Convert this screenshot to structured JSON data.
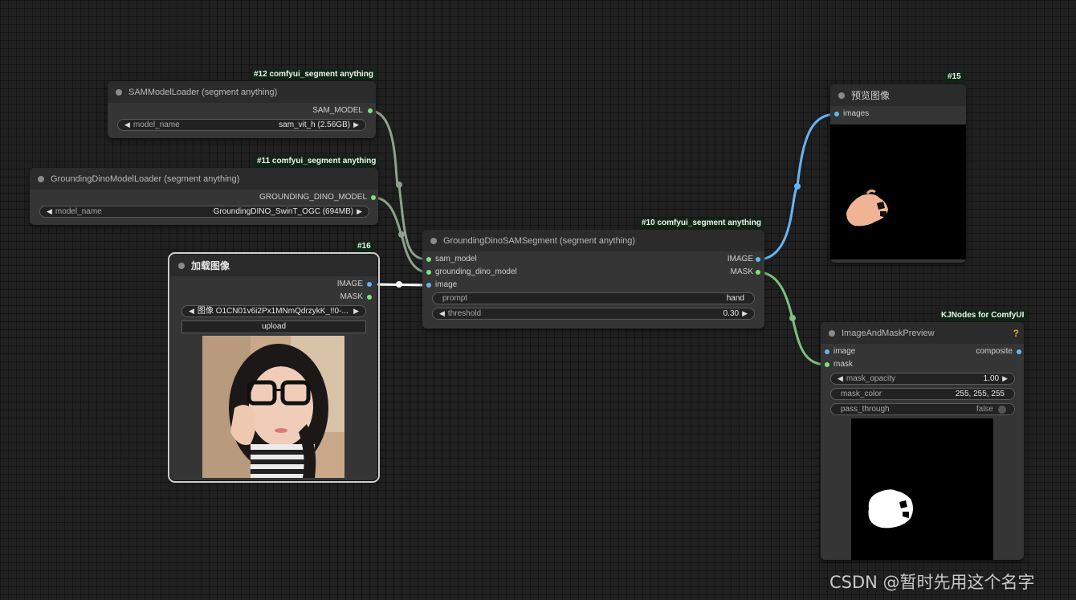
{
  "colors": {
    "canvas_bg": "#202020",
    "node_bg": "#353535",
    "node_title_bg": "#2b2b2b",
    "wire_model": "#8fa08f",
    "wire_image": "#64b5f6",
    "wire_mask": "#7ec07e",
    "wire_selected": "#ffffff",
    "slot_green": "#7ee07e",
    "slot_blue": "#64b5f6",
    "badge_bg": "#0f2614",
    "help_icon": "#f0a020"
  },
  "nodes": {
    "sam_loader": {
      "badge": "#12 comfyui_segment anything",
      "title": "SAMModelLoader (segment anything)",
      "output": "SAM_MODEL",
      "widget_label": "model_name",
      "widget_value": "sam_vit_h (2.56GB)"
    },
    "dino_loader": {
      "badge": "#11 comfyui_segment anything",
      "title": "GroundingDinoModelLoader (segment anything)",
      "output": "GROUNDING_DINO_MODEL",
      "widget_label": "model_name",
      "widget_value": "GroundingDINO_SwinT_OGC (694MB)"
    },
    "load_image": {
      "badge": "#16",
      "title": "加载图像",
      "outputs": [
        "IMAGE",
        "MASK"
      ],
      "widget_value": "图像  O1CN01v6i2Px1MNmQdrzykK_!!0-...",
      "upload_label": "upload"
    },
    "segment": {
      "badge": "#10 comfyui_segment anything",
      "title": "GroundingDinoSAMSegment (segment anything)",
      "inputs": [
        "sam_model",
        "grounding_dino_model",
        "image"
      ],
      "outputs": [
        "IMAGE",
        "MASK"
      ],
      "prompt_label": "prompt",
      "prompt_value": "hand",
      "threshold_label": "threshold",
      "threshold_value": "0.30"
    },
    "preview": {
      "badge": "#15",
      "title": "预览图像",
      "input": "images"
    },
    "mask_preview": {
      "badge": "KJNodes for ComfyUI",
      "title": "ImageAndMaskPreview",
      "help": "?",
      "inputs": [
        "image",
        "mask"
      ],
      "output": "composite",
      "mask_opacity_label": "mask_opacity",
      "mask_opacity_value": "1.00",
      "mask_color_label": "mask_color",
      "mask_color_value": "255, 255, 255",
      "pass_through_label": "pass_through",
      "pass_through_value": "false"
    }
  },
  "watermark": "CSDN @暂时先用这个名字"
}
